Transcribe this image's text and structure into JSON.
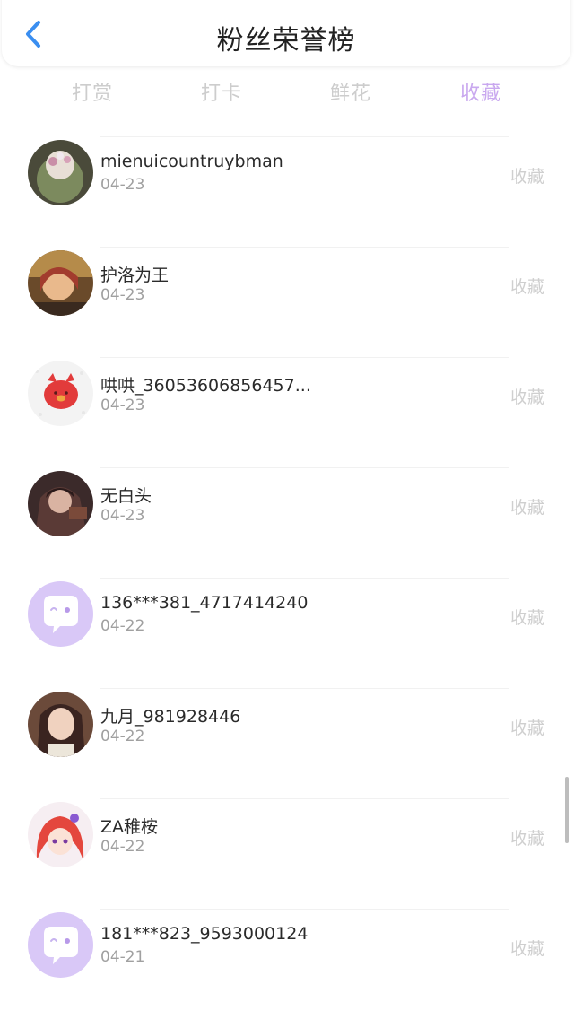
{
  "header": {
    "title": "粉丝荣誉榜",
    "back_icon": "chevron-left-icon",
    "accent_color": "#3a8ef0"
  },
  "tabs": [
    {
      "label": "打赏",
      "active": false
    },
    {
      "label": "打卡",
      "active": false
    },
    {
      "label": "鲜花",
      "active": false
    },
    {
      "label": "收藏",
      "active": true
    }
  ],
  "colors": {
    "active_tab": "#c9a8ef",
    "inactive_tab": "#cdcdcd"
  },
  "list": [
    {
      "name": "mienuicountruybman",
      "date": "04-23",
      "action": "收藏",
      "avatar": "cactus-photo-avatar"
    },
    {
      "name": "护洛为王",
      "date": "04-23",
      "action": "收藏",
      "avatar": "anime-girl-avatar"
    },
    {
      "name": "哄哄_36053606856457...",
      "date": "04-23",
      "action": "收藏",
      "avatar": "red-pig-avatar"
    },
    {
      "name": "无白头",
      "date": "04-23",
      "action": "收藏",
      "avatar": "dark-character-avatar"
    },
    {
      "name": "136***381_4717414240",
      "date": "04-22",
      "action": "收藏",
      "avatar": "default-chat-bubble-avatar"
    },
    {
      "name": "九月_981928446",
      "date": "04-22",
      "action": "收藏",
      "avatar": "girl-photo-avatar"
    },
    {
      "name": "ZA稚桉",
      "date": "04-22",
      "action": "收藏",
      "avatar": "red-hair-anime-avatar"
    },
    {
      "name": "181***823_9593000124",
      "date": "04-21",
      "action": "收藏",
      "avatar": "default-chat-bubble-avatar"
    }
  ]
}
